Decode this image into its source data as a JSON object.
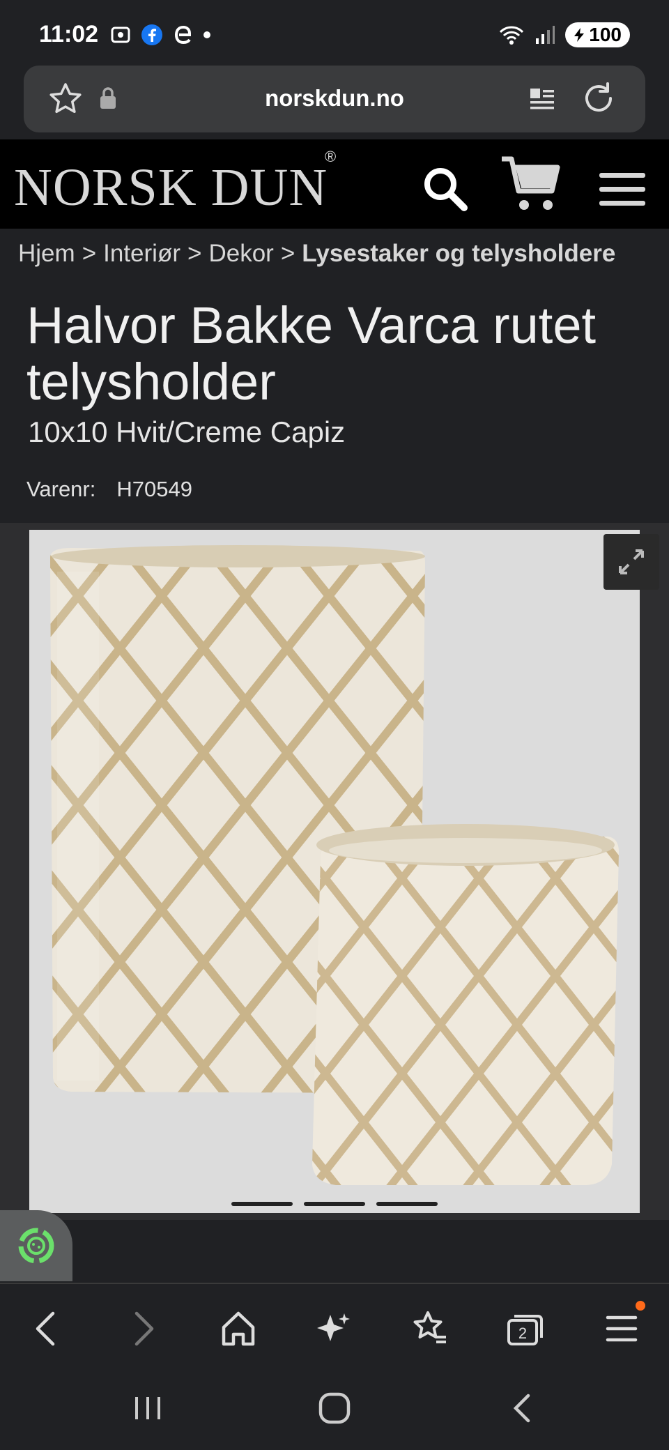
{
  "status_bar": {
    "time": "11:02",
    "battery": "100",
    "icons": [
      "screenshot-icon",
      "facebook-icon",
      "e-icon",
      "dot-icon",
      "wifi-icon",
      "signal-icon",
      "battery-icon"
    ]
  },
  "browser": {
    "url": "norskdun.no"
  },
  "site": {
    "logo": "NORSK DUN",
    "logo_mark": "®"
  },
  "breadcrumb": {
    "items": [
      "Hjem",
      "Interiør",
      "Dekor",
      "Lysestaker og telysholdere"
    ],
    "separator": ">"
  },
  "product": {
    "title": "Halvor Bakke Varca rutet telysholder",
    "subtitle": "10x10 Hvit/Creme Capiz",
    "sku_label": "Varenr:",
    "sku_value": "H70549"
  },
  "gallery": {
    "image_count": 3,
    "active_index": 0
  },
  "colors": {
    "background": "#202124",
    "header": "#000000",
    "accent_dot": "#ff6a1a"
  }
}
